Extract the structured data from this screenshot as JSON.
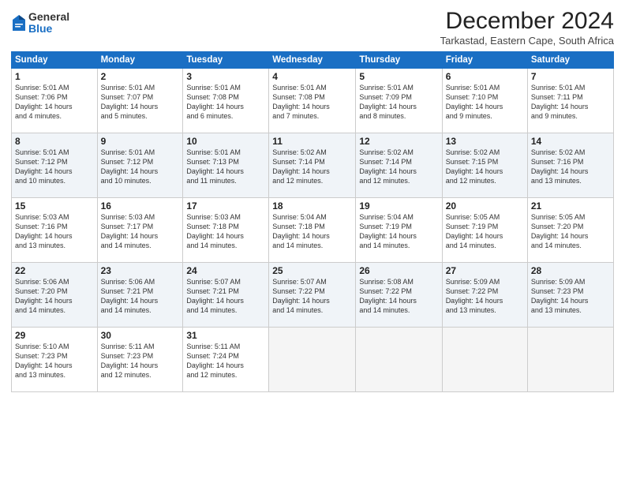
{
  "logo": {
    "general": "General",
    "blue": "Blue"
  },
  "header": {
    "title": "December 2024",
    "location": "Tarkastad, Eastern Cape, South Africa"
  },
  "days_of_week": [
    "Sunday",
    "Monday",
    "Tuesday",
    "Wednesday",
    "Thursday",
    "Friday",
    "Saturday"
  ],
  "weeks": [
    [
      {
        "day": 1,
        "lines": [
          "Sunrise: 5:01 AM",
          "Sunset: 7:06 PM",
          "Daylight: 14 hours",
          "and 4 minutes."
        ]
      },
      {
        "day": 2,
        "lines": [
          "Sunrise: 5:01 AM",
          "Sunset: 7:07 PM",
          "Daylight: 14 hours",
          "and 5 minutes."
        ]
      },
      {
        "day": 3,
        "lines": [
          "Sunrise: 5:01 AM",
          "Sunset: 7:08 PM",
          "Daylight: 14 hours",
          "and 6 minutes."
        ]
      },
      {
        "day": 4,
        "lines": [
          "Sunrise: 5:01 AM",
          "Sunset: 7:08 PM",
          "Daylight: 14 hours",
          "and 7 minutes."
        ]
      },
      {
        "day": 5,
        "lines": [
          "Sunrise: 5:01 AM",
          "Sunset: 7:09 PM",
          "Daylight: 14 hours",
          "and 8 minutes."
        ]
      },
      {
        "day": 6,
        "lines": [
          "Sunrise: 5:01 AM",
          "Sunset: 7:10 PM",
          "Daylight: 14 hours",
          "and 9 minutes."
        ]
      },
      {
        "day": 7,
        "lines": [
          "Sunrise: 5:01 AM",
          "Sunset: 7:11 PM",
          "Daylight: 14 hours",
          "and 9 minutes."
        ]
      }
    ],
    [
      {
        "day": 8,
        "lines": [
          "Sunrise: 5:01 AM",
          "Sunset: 7:12 PM",
          "Daylight: 14 hours",
          "and 10 minutes."
        ]
      },
      {
        "day": 9,
        "lines": [
          "Sunrise: 5:01 AM",
          "Sunset: 7:12 PM",
          "Daylight: 14 hours",
          "and 10 minutes."
        ]
      },
      {
        "day": 10,
        "lines": [
          "Sunrise: 5:01 AM",
          "Sunset: 7:13 PM",
          "Daylight: 14 hours",
          "and 11 minutes."
        ]
      },
      {
        "day": 11,
        "lines": [
          "Sunrise: 5:02 AM",
          "Sunset: 7:14 PM",
          "Daylight: 14 hours",
          "and 12 minutes."
        ]
      },
      {
        "day": 12,
        "lines": [
          "Sunrise: 5:02 AM",
          "Sunset: 7:14 PM",
          "Daylight: 14 hours",
          "and 12 minutes."
        ]
      },
      {
        "day": 13,
        "lines": [
          "Sunrise: 5:02 AM",
          "Sunset: 7:15 PM",
          "Daylight: 14 hours",
          "and 12 minutes."
        ]
      },
      {
        "day": 14,
        "lines": [
          "Sunrise: 5:02 AM",
          "Sunset: 7:16 PM",
          "Daylight: 14 hours",
          "and 13 minutes."
        ]
      }
    ],
    [
      {
        "day": 15,
        "lines": [
          "Sunrise: 5:03 AM",
          "Sunset: 7:16 PM",
          "Daylight: 14 hours",
          "and 13 minutes."
        ]
      },
      {
        "day": 16,
        "lines": [
          "Sunrise: 5:03 AM",
          "Sunset: 7:17 PM",
          "Daylight: 14 hours",
          "and 14 minutes."
        ]
      },
      {
        "day": 17,
        "lines": [
          "Sunrise: 5:03 AM",
          "Sunset: 7:18 PM",
          "Daylight: 14 hours",
          "and 14 minutes."
        ]
      },
      {
        "day": 18,
        "lines": [
          "Sunrise: 5:04 AM",
          "Sunset: 7:18 PM",
          "Daylight: 14 hours",
          "and 14 minutes."
        ]
      },
      {
        "day": 19,
        "lines": [
          "Sunrise: 5:04 AM",
          "Sunset: 7:19 PM",
          "Daylight: 14 hours",
          "and 14 minutes."
        ]
      },
      {
        "day": 20,
        "lines": [
          "Sunrise: 5:05 AM",
          "Sunset: 7:19 PM",
          "Daylight: 14 hours",
          "and 14 minutes."
        ]
      },
      {
        "day": 21,
        "lines": [
          "Sunrise: 5:05 AM",
          "Sunset: 7:20 PM",
          "Daylight: 14 hours",
          "and 14 minutes."
        ]
      }
    ],
    [
      {
        "day": 22,
        "lines": [
          "Sunrise: 5:06 AM",
          "Sunset: 7:20 PM",
          "Daylight: 14 hours",
          "and 14 minutes."
        ]
      },
      {
        "day": 23,
        "lines": [
          "Sunrise: 5:06 AM",
          "Sunset: 7:21 PM",
          "Daylight: 14 hours",
          "and 14 minutes."
        ]
      },
      {
        "day": 24,
        "lines": [
          "Sunrise: 5:07 AM",
          "Sunset: 7:21 PM",
          "Daylight: 14 hours",
          "and 14 minutes."
        ]
      },
      {
        "day": 25,
        "lines": [
          "Sunrise: 5:07 AM",
          "Sunset: 7:22 PM",
          "Daylight: 14 hours",
          "and 14 minutes."
        ]
      },
      {
        "day": 26,
        "lines": [
          "Sunrise: 5:08 AM",
          "Sunset: 7:22 PM",
          "Daylight: 14 hours",
          "and 14 minutes."
        ]
      },
      {
        "day": 27,
        "lines": [
          "Sunrise: 5:09 AM",
          "Sunset: 7:22 PM",
          "Daylight: 14 hours",
          "and 13 minutes."
        ]
      },
      {
        "day": 28,
        "lines": [
          "Sunrise: 5:09 AM",
          "Sunset: 7:23 PM",
          "Daylight: 14 hours",
          "and 13 minutes."
        ]
      }
    ],
    [
      {
        "day": 29,
        "lines": [
          "Sunrise: 5:10 AM",
          "Sunset: 7:23 PM",
          "Daylight: 14 hours",
          "and 13 minutes."
        ]
      },
      {
        "day": 30,
        "lines": [
          "Sunrise: 5:11 AM",
          "Sunset: 7:23 PM",
          "Daylight: 14 hours",
          "and 12 minutes."
        ]
      },
      {
        "day": 31,
        "lines": [
          "Sunrise: 5:11 AM",
          "Sunset: 7:24 PM",
          "Daylight: 14 hours",
          "and 12 minutes."
        ]
      },
      null,
      null,
      null,
      null
    ]
  ]
}
